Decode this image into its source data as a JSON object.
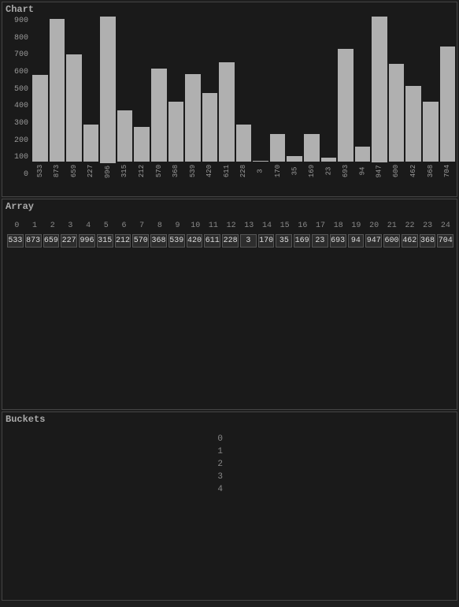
{
  "chart": {
    "label": "Chart",
    "y_axis": [
      "900",
      "800",
      "700",
      "600",
      "500",
      "400",
      "300",
      "200",
      "100",
      "0"
    ],
    "max_value": 996,
    "bars": [
      {
        "value": 533,
        "label": "533"
      },
      {
        "value": 873,
        "label": "873"
      },
      {
        "value": 659,
        "label": "659"
      },
      {
        "value": 227,
        "label": "227"
      },
      {
        "value": 996,
        "label": "996"
      },
      {
        "value": 315,
        "label": "315"
      },
      {
        "value": 212,
        "label": "212"
      },
      {
        "value": 570,
        "label": "570"
      },
      {
        "value": 368,
        "label": "368"
      },
      {
        "value": 539,
        "label": "539"
      },
      {
        "value": 420,
        "label": "420"
      },
      {
        "value": 611,
        "label": "611"
      },
      {
        "value": 228,
        "label": "228"
      },
      {
        "value": 3,
        "label": "3"
      },
      {
        "value": 170,
        "label": "170"
      },
      {
        "value": 35,
        "label": "35"
      },
      {
        "value": 169,
        "label": "169"
      },
      {
        "value": 23,
        "label": "23"
      },
      {
        "value": 693,
        "label": "693"
      },
      {
        "value": 94,
        "label": "94"
      },
      {
        "value": 947,
        "label": "947"
      },
      {
        "value": 600,
        "label": "600"
      },
      {
        "value": 462,
        "label": "462"
      },
      {
        "value": 368,
        "label": "368"
      },
      {
        "value": 704,
        "label": "704"
      }
    ]
  },
  "array": {
    "label": "Array",
    "indices": [
      0,
      1,
      2,
      3,
      4,
      5,
      6,
      7,
      8,
      9,
      10,
      11,
      12,
      13,
      14,
      15,
      16,
      17,
      18,
      19,
      20,
      21,
      22,
      23,
      24
    ],
    "values": [
      533,
      873,
      659,
      227,
      996,
      315,
      212,
      570,
      368,
      539,
      420,
      611,
      228,
      3,
      170,
      35,
      169,
      23,
      693,
      94,
      947,
      600,
      462,
      368,
      704
    ]
  },
  "buckets": {
    "label": "Buckets",
    "rows": [
      0,
      1,
      2,
      3,
      4
    ]
  }
}
